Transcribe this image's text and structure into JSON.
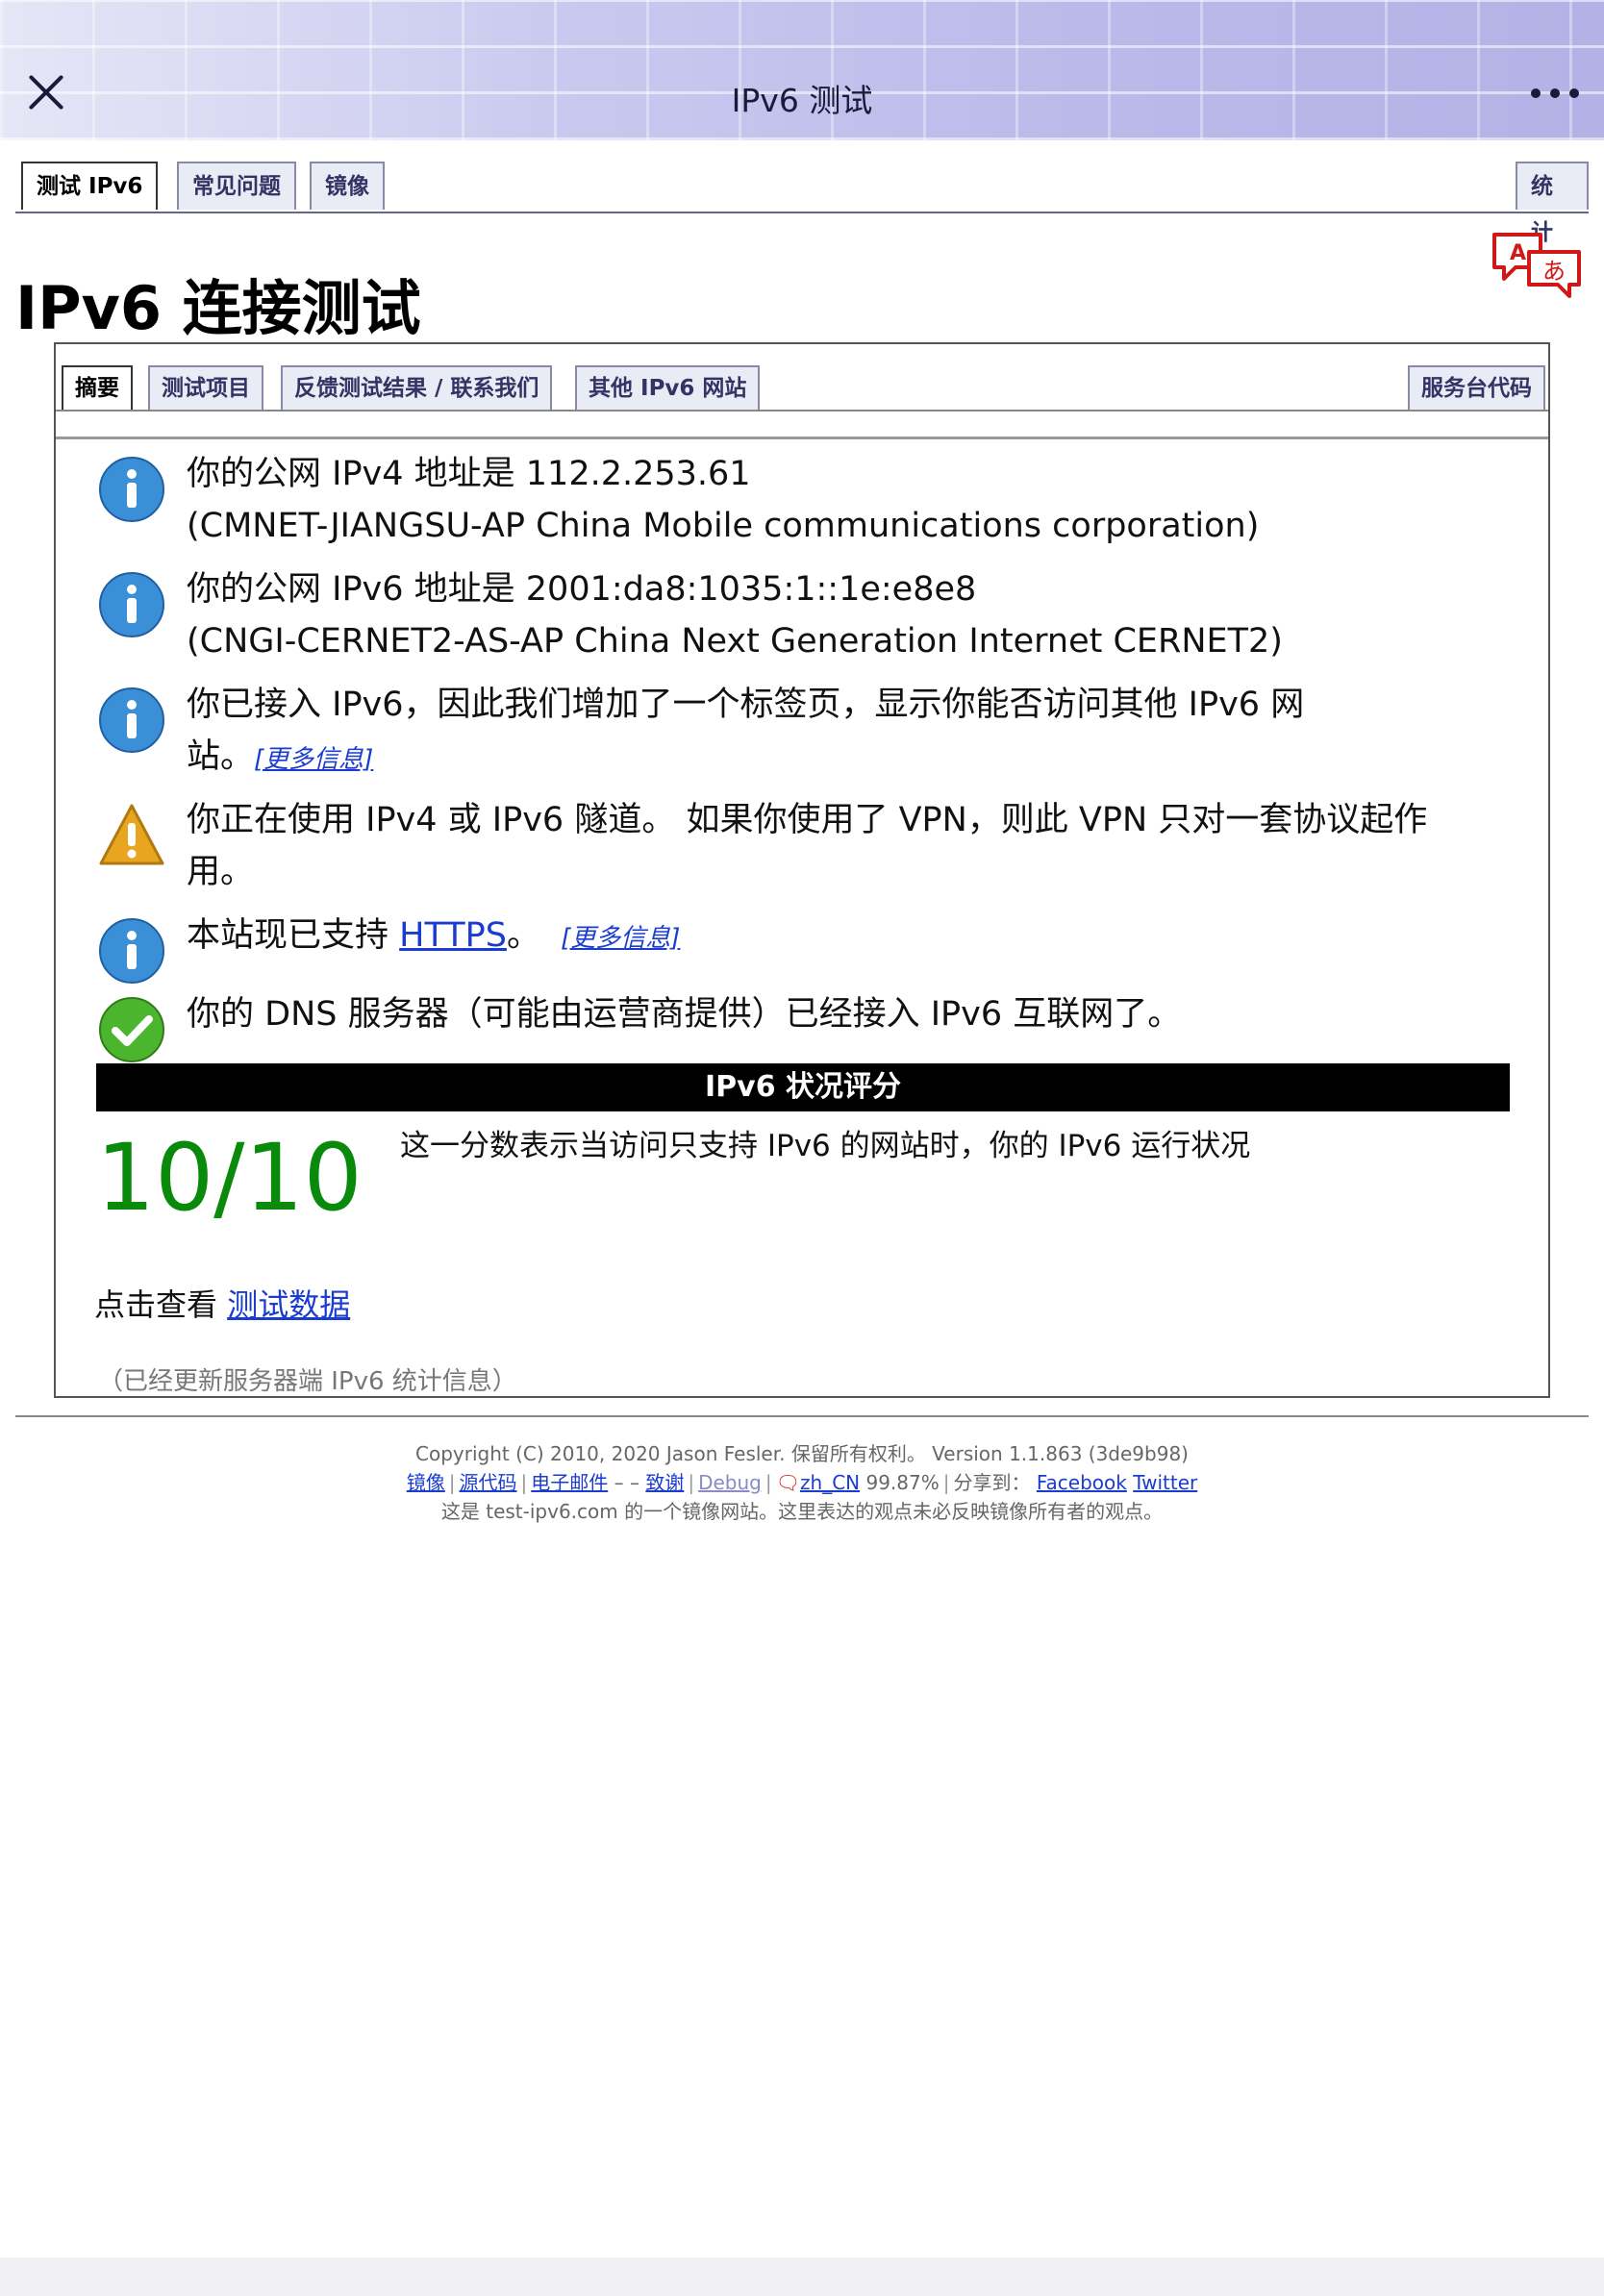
{
  "topbar": {
    "title": "IPv6 测试"
  },
  "top_tabs": [
    {
      "label": "测试 IPv6",
      "active": true
    },
    {
      "label": "常见问题",
      "active": false
    },
    {
      "label": "镜像",
      "active": false
    },
    {
      "label": "统计",
      "active": false
    }
  ],
  "page_title": "IPv6 连接测试",
  "inner_tabs": [
    {
      "label": "摘要",
      "active": true
    },
    {
      "label": "测试项目",
      "active": false
    },
    {
      "label": "反馈测试结果 / 联系我们",
      "active": false
    },
    {
      "label": "其他 IPv6 网站",
      "active": false
    },
    {
      "label": "服务台代码",
      "active": false
    }
  ],
  "results": [
    {
      "icon": "info-icon",
      "line1": "你的公网 IPv4 地址是 112.2.253.61",
      "line2": "(CMNET-JIANGSU-AP China Mobile communications corporation)"
    },
    {
      "icon": "info-icon",
      "line1": "你的公网 IPv6 地址是 2001:da8:1035:1::1e:e8e8",
      "line2": "(CNGI-CERNET2-AS-AP China Next Generation Internet CERNET2)"
    },
    {
      "icon": "info-icon",
      "line1": "你已接入 IPv6，因此我们增加了一个标签页，显示你能否访问其他 IPv6 网",
      "line2": "站。",
      "more": "[更多信息]"
    },
    {
      "icon": "warning-icon",
      "line1": "你正在使用 IPv4 或 IPv6 隧道。 如果你使用了 VPN，则此 VPN 只对一套协议起作",
      "line2": "用。"
    },
    {
      "icon": "info-icon",
      "prefix": "本站现已支持 ",
      "link": "HTTPS",
      "suffix": "。",
      "more": "[更多信息]"
    },
    {
      "icon": "check-icon",
      "line1": "你的 DNS 服务器（可能由运营商提供）已经接入 IPv6 互联网了。"
    }
  ],
  "score": {
    "header": "IPv6 状况评分",
    "value": "10/10",
    "description": "这一分数表示当访问只支持 IPv6 的网站时，你的 IPv6 运行状况"
  },
  "view_data": {
    "prefix": "点击查看 ",
    "link": "测试数据"
  },
  "stats_note": "（已经更新服务器端 IPv6 统计信息）",
  "footer": {
    "copyright": "Copyright (C) 2010, 2020 Jason Fesler. 保留所有权利。 Version 1.1.863 (3de9b98)",
    "links": {
      "mirror": "镜像",
      "source": "源代码",
      "email": "电子邮件",
      "dash": "–",
      "thanks": "致谢",
      "debug": "Debug",
      "locale": "zh_CN",
      "locale_pct": "99.87%",
      "share": "分享到：",
      "facebook": "Facebook",
      "twitter": "Twitter"
    },
    "mirror_note": "这是 test-ipv6.com 的一个镜像网站。这里表达的观点未必反映镜像所有者的观点。"
  },
  "colors": {
    "score": "#0a8a0a",
    "link": "#1a3ccf",
    "topbar": "#c7c7ee"
  }
}
